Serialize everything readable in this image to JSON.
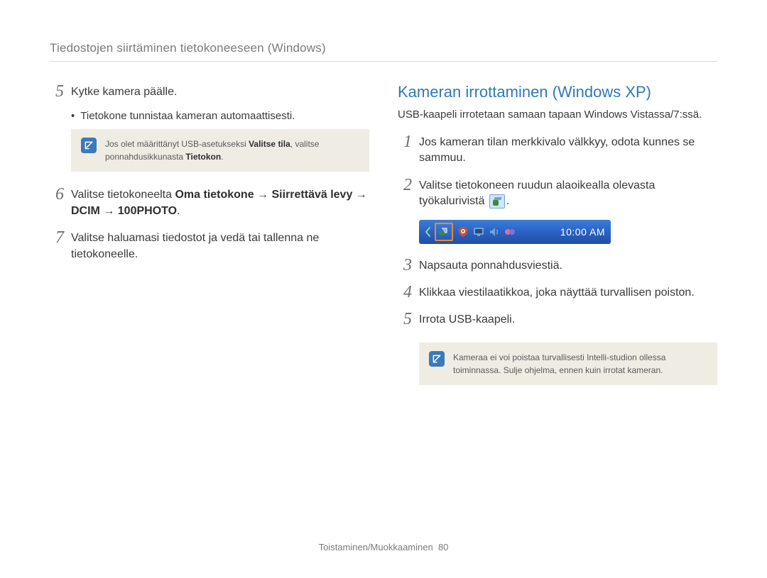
{
  "breadcrumb": "Tiedostojen siirtäminen tietokoneeseen (Windows)",
  "left": {
    "steps": {
      "s5": {
        "num": "5",
        "text": "Kytke kamera päälle."
      },
      "s5_sub": "Tietokone tunnistaa kameran automaattisesti.",
      "note1_a": "Jos olet määrittänyt USB-asetukseksi ",
      "note1_bold1": "Valitse tila",
      "note1_b": ", valitse ponnahdusikkunasta ",
      "note1_bold2": "Tietokon",
      "note1_c": ".",
      "s6": {
        "num": "6",
        "pre": "Valitse tietokoneelta ",
        "b1": "Oma tietokone",
        "arrow": " → ",
        "b2": "Siirrettävä levy",
        "b3": "DCIM",
        "b4": "100PHOTO",
        "post": "."
      },
      "s7": {
        "num": "7",
        "text": "Valitse haluamasi tiedostot ja vedä tai tallenna ne tietokoneelle."
      }
    }
  },
  "right": {
    "title": "Kameran irrottaminen (Windows XP)",
    "sub": "USB-kaapeli irrotetaan samaan tapaan Windows Vistassa/7:ssä.",
    "steps": {
      "s1": {
        "num": "1",
        "text": "Jos kameran tilan merkkivalo välkkyy, odota kunnes se sammuu."
      },
      "s2": {
        "num": "2",
        "text_a": "Valitse tietokoneen ruudun alaoikealla olevasta työkalurivistä ",
        "text_b": "."
      },
      "s3": {
        "num": "3",
        "text": "Napsauta ponnahdusviestiä."
      },
      "s4": {
        "num": "4",
        "text": "Klikkaa viestilaatikkoa, joka näyttää turvallisen poiston."
      },
      "s5": {
        "num": "5",
        "text": "Irrota USB-kaapeli."
      }
    },
    "taskbar_time": "10:00 AM",
    "note2_a": "Kameraa ei voi poistaa turvallisesti Intelli-studion ollessa toiminnassa. Sulje ohjelma, ennen kuin irrotat kameran."
  },
  "footer": {
    "section": "Toistaminen/Muokkaaminen",
    "page": "80"
  }
}
